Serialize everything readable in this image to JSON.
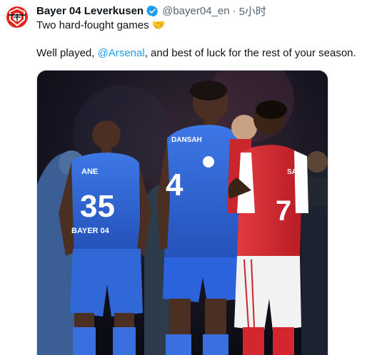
{
  "tweet": {
    "author_name": "Bayer 04 Leverkusen",
    "author_handle": "@bayer04_en",
    "separator": "·",
    "time": "5小时",
    "line1": "Two hard-fought games",
    "line1_emoji": "🤝",
    "line2_pre": "Well played, ",
    "line2_mention": "@Arsenal",
    "line2_post": ", and best of luck for the rest of your season."
  },
  "image": {
    "kits": {
      "player_left_number": "35",
      "player_left_name": "ANE",
      "player_left_sponsor": "BAYER 04",
      "player_center_number": "4",
      "player_center_name": "DANSAH",
      "player_right_number": "7",
      "player_right_name": "SAKA"
    }
  },
  "colors": {
    "accent": "#1d9bf0",
    "muted": "#536471",
    "verified": "#1d9bf0",
    "leverkusen_blue": "#2f62d6",
    "arsenal_red": "#d3262e"
  },
  "icons": {
    "avatar": "bayer-leverkusen-crest-icon",
    "verified": "verified-badge-icon"
  }
}
